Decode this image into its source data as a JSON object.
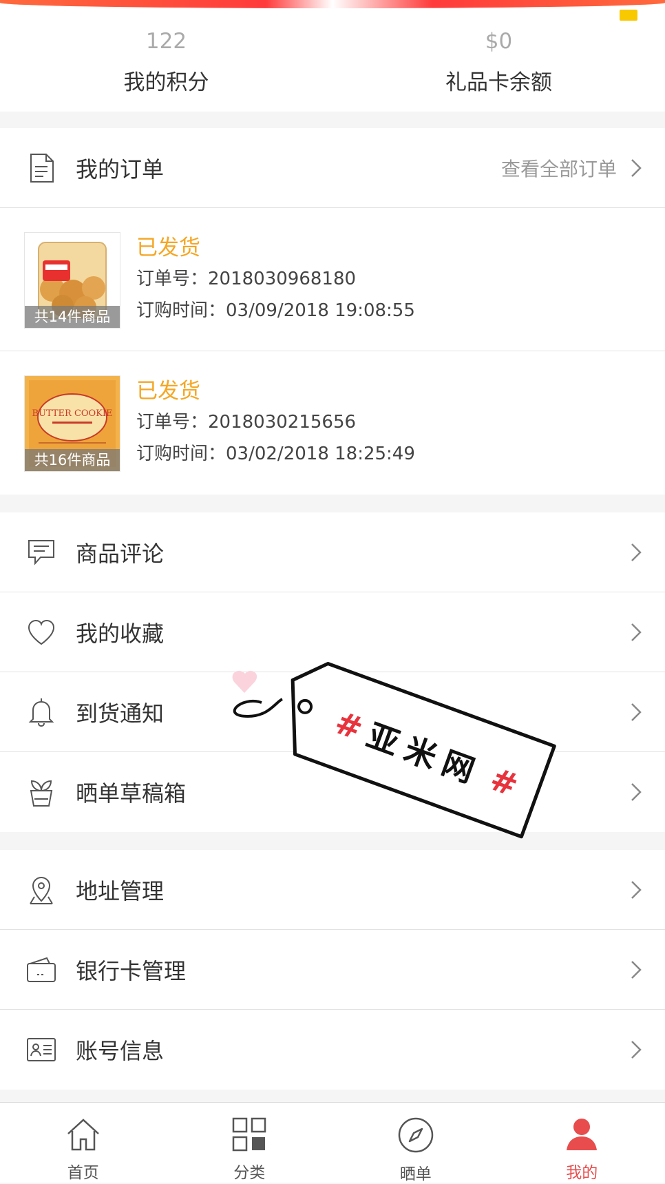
{
  "stats": {
    "points": {
      "value": "122",
      "label": "我的积分"
    },
    "giftcard": {
      "value": "$0",
      "label": "礼品卡余额"
    }
  },
  "orders_header": {
    "label": "我的订单",
    "link": "查看全部订单"
  },
  "orders": [
    {
      "status": "已发货",
      "number": "订单号：2018030968180",
      "time": "订购时间：03/09/2018 19:08:55",
      "count": "共14件商品"
    },
    {
      "status": "已发货",
      "number": "订单号：2018030215656",
      "time": "订购时间：03/02/2018 18:25:49",
      "count": "共16件商品"
    }
  ],
  "menu1": [
    {
      "label": "商品评论",
      "icon": "comment-icon"
    },
    {
      "label": "我的收藏",
      "icon": "heart-icon"
    },
    {
      "label": "到货通知",
      "icon": "bell-icon"
    },
    {
      "label": "晒单草稿箱",
      "icon": "plant-pot-icon"
    }
  ],
  "menu2": [
    {
      "label": "地址管理",
      "icon": "location-pin-icon"
    },
    {
      "label": "银行卡管理",
      "icon": "wallet-icon"
    },
    {
      "label": "账号信息",
      "icon": "id-card-icon"
    }
  ],
  "tabs": [
    {
      "label": "首页",
      "icon": "home-icon"
    },
    {
      "label": "分类",
      "icon": "category-grid-icon"
    },
    {
      "label": "晒单",
      "icon": "compass-icon"
    },
    {
      "label": "我的",
      "icon": "user-icon",
      "active": true
    }
  ],
  "watermark": {
    "text": "亚米网"
  },
  "colors": {
    "accent": "#e84c4c",
    "status": "#f5a623",
    "brand_bar": "#ff3b3b"
  }
}
